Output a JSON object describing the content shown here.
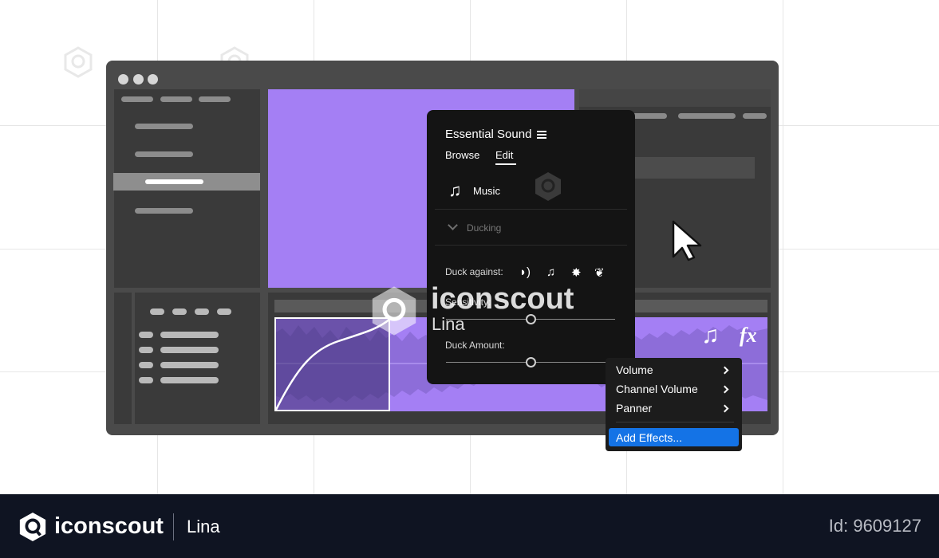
{
  "essential_sound": {
    "title": "Essential Sound",
    "tabs": [
      {
        "label": "Browse",
        "active": false
      },
      {
        "label": "Edit",
        "active": true
      }
    ],
    "clip_type": {
      "icon": "music-note-icon",
      "label": "Music"
    },
    "section": {
      "label": "Ducking",
      "icon": "chevron-down-icon"
    },
    "duck_against_label": "Duck against:",
    "duck_against_icons": [
      "dialogue-icon",
      "music-note-icon",
      "sfx-burst-icon",
      "ambience-leaf-icon"
    ],
    "sensitivity_label": "Sensitivity:",
    "duck_amount_label": "Duck Amount:",
    "sensitivity_value": 0.5,
    "duck_amount_value": 0.5
  },
  "context_menu": {
    "items": [
      {
        "label": "Volume",
        "submenu": true
      },
      {
        "label": "Channel Volume",
        "submenu": true
      },
      {
        "label": "Panner",
        "submenu": true
      }
    ],
    "highlighted_item": {
      "label": "Add Effects..."
    }
  },
  "track": {
    "icons": [
      "music-note-icon",
      "fx-icon"
    ],
    "fx_label": "fx"
  },
  "watermark": {
    "brand": "iconscout",
    "author": "Lina"
  },
  "footer": {
    "brand": "iconscout",
    "author": "Lina",
    "id_text": "Id: 9609127"
  },
  "colors": {
    "accent_purple": "#a47ff4",
    "menu_highlight": "#1473e6",
    "window_bg": "#4a4a4a",
    "panel_bg": "#141414",
    "footer_bg": "#0f1422"
  }
}
